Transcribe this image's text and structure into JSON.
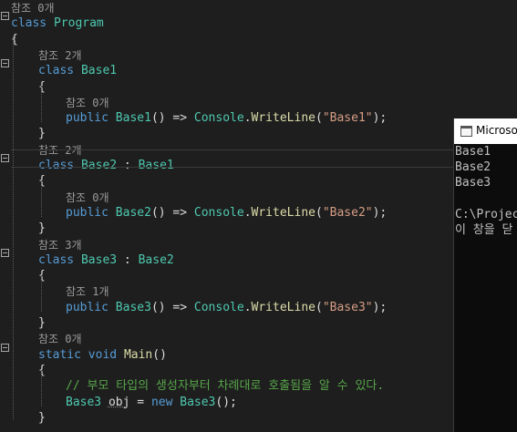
{
  "editor": {
    "lines": [
      {
        "ref": "참조 0개"
      },
      {
        "parts": [
          [
            "kw",
            "class"
          ],
          [
            "plain",
            " "
          ],
          [
            "type",
            "Program"
          ]
        ]
      },
      {
        "parts": [
          [
            "plain",
            "{"
          ]
        ]
      },
      {
        "ref": "참조 2개"
      },
      {
        "parts": [
          [
            "kw",
            "class"
          ],
          [
            "plain",
            " "
          ],
          [
            "type",
            "Base1"
          ]
        ]
      },
      {
        "parts": [
          [
            "plain",
            "{"
          ]
        ]
      },
      {
        "ref": "참조 0개"
      },
      {
        "parts": [
          [
            "kw",
            "public"
          ],
          [
            "plain",
            " "
          ],
          [
            "type",
            "Base1"
          ],
          [
            "plain",
            "() => "
          ],
          [
            "type",
            "Console"
          ],
          [
            "plain",
            "."
          ],
          [
            "method",
            "WriteLine"
          ],
          [
            "plain",
            "("
          ],
          [
            "str",
            "\"Base1\""
          ],
          [
            "plain",
            ");"
          ]
        ]
      },
      {
        "parts": [
          [
            "plain",
            "}"
          ]
        ]
      },
      {
        "ref": "참조 2개"
      },
      {
        "parts": [
          [
            "kw",
            "class"
          ],
          [
            "plain",
            " "
          ],
          [
            "type",
            "Base2"
          ],
          [
            "plain",
            " : "
          ],
          [
            "type",
            "Base1"
          ]
        ]
      },
      {
        "parts": [
          [
            "plain",
            "{"
          ]
        ]
      },
      {
        "ref": "참조 0개"
      },
      {
        "parts": [
          [
            "kw",
            "public"
          ],
          [
            "plain",
            " "
          ],
          [
            "type",
            "Base2"
          ],
          [
            "plain",
            "() => "
          ],
          [
            "type",
            "Console"
          ],
          [
            "plain",
            "."
          ],
          [
            "method",
            "WriteLine"
          ],
          [
            "plain",
            "("
          ],
          [
            "str",
            "\"Base2\""
          ],
          [
            "plain",
            ");"
          ]
        ]
      },
      {
        "parts": [
          [
            "plain",
            "}"
          ]
        ]
      },
      {
        "ref": "참조 3개"
      },
      {
        "parts": [
          [
            "kw",
            "class"
          ],
          [
            "plain",
            " "
          ],
          [
            "type",
            "Base3"
          ],
          [
            "plain",
            " : "
          ],
          [
            "type",
            "Base2"
          ]
        ]
      },
      {
        "parts": [
          [
            "plain",
            "{"
          ]
        ]
      },
      {
        "ref": "참조 1개"
      },
      {
        "parts": [
          [
            "kw",
            "public"
          ],
          [
            "plain",
            " "
          ],
          [
            "type",
            "Base3"
          ],
          [
            "plain",
            "() => "
          ],
          [
            "type",
            "Console"
          ],
          [
            "plain",
            "."
          ],
          [
            "method",
            "WriteLine"
          ],
          [
            "plain",
            "("
          ],
          [
            "str",
            "\"Base3\""
          ],
          [
            "plain",
            ");"
          ]
        ]
      },
      {
        "parts": [
          [
            "plain",
            "}"
          ]
        ]
      },
      {
        "ref": "참조 0개"
      },
      {
        "parts": [
          [
            "kw",
            "static"
          ],
          [
            "plain",
            " "
          ],
          [
            "kw",
            "void"
          ],
          [
            "plain",
            " "
          ],
          [
            "method",
            "Main"
          ],
          [
            "plain",
            "()"
          ]
        ]
      },
      {
        "parts": [
          [
            "plain",
            "{"
          ]
        ]
      },
      {
        "parts": [
          [
            "cmt",
            "// 부모 타입의 생성자부터 차례대로 호출됨을 알 수 있다."
          ]
        ]
      },
      {
        "parts": [
          [
            "type",
            "Base3"
          ],
          [
            "plain",
            " "
          ],
          [
            "squig",
            "obj"
          ],
          [
            "plain",
            " = "
          ],
          [
            "kw",
            "new"
          ],
          [
            "plain",
            " "
          ],
          [
            "type",
            "Base3"
          ],
          [
            "plain",
            "();"
          ]
        ]
      },
      {
        "parts": [
          [
            "plain",
            "}"
          ]
        ]
      }
    ]
  },
  "console": {
    "title": "Microso",
    "lines": [
      "Base1",
      "Base2",
      "Base3",
      "",
      "C:\\Projec",
      "이 창을 닫"
    ]
  },
  "colors": {
    "background": "#1e1e1e",
    "keyword": "#569cd6",
    "type": "#4ec9b0",
    "method": "#dcdcaa",
    "string": "#d69d85",
    "comment": "#57a64a",
    "reference_hint": "#999999"
  }
}
